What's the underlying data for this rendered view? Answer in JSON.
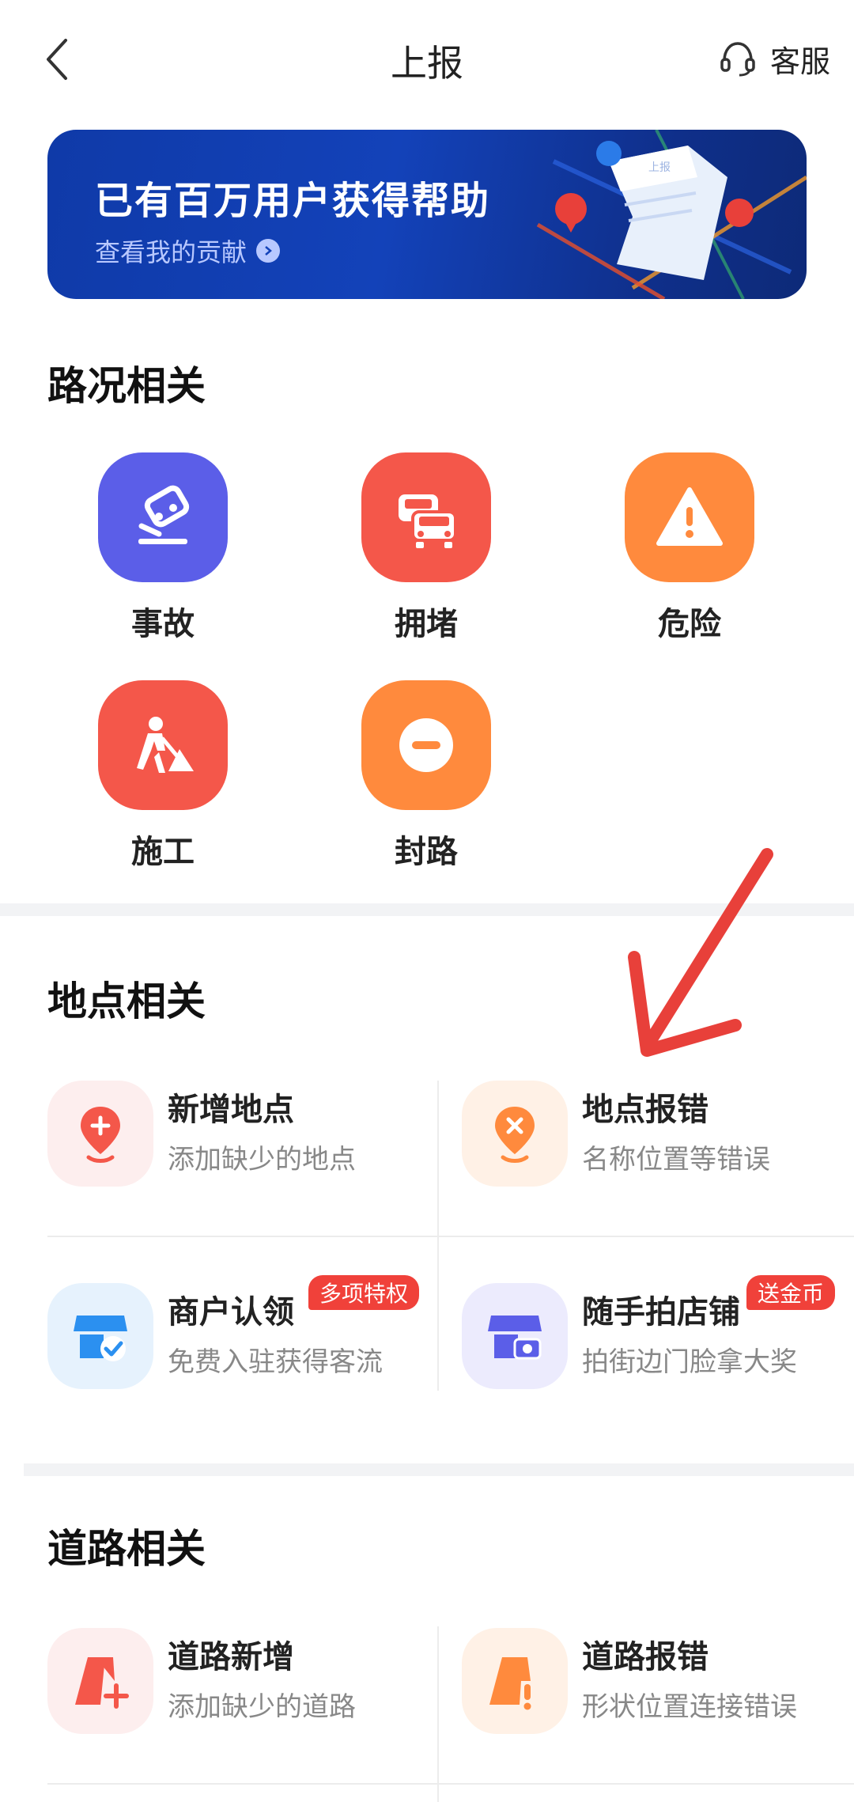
{
  "header": {
    "title": "上报",
    "service_label": "客服"
  },
  "banner": {
    "title": "已有百万用户获得帮助",
    "link_label": "查看我的贡献",
    "paper_text": "上报"
  },
  "road_conditions": {
    "title": "路况相关",
    "items": [
      {
        "label": "事故",
        "icon": "accident-icon",
        "color": "#5b5ee8"
      },
      {
        "label": "拥堵",
        "icon": "traffic-jam-icon",
        "color": "#f4574a"
      },
      {
        "label": "危险",
        "icon": "warning-icon",
        "color": "#ff8a3d"
      },
      {
        "label": "施工",
        "icon": "construction-icon",
        "color": "#f4574a"
      },
      {
        "label": "封路",
        "icon": "road-closed-icon",
        "color": "#ff8a3d"
      }
    ]
  },
  "places": {
    "title": "地点相关",
    "items": [
      {
        "title": "新增地点",
        "subtitle": "添加缺少的地点",
        "icon": "add-location-icon"
      },
      {
        "title": "地点报错",
        "subtitle": "名称位置等错误",
        "icon": "location-error-icon"
      },
      {
        "title": "商户认领",
        "subtitle": "免费入驻获得客流",
        "badge": "多项特权",
        "icon": "merchant-claim-icon"
      },
      {
        "title": "随手拍店铺",
        "subtitle": "拍街边门脸拿大奖",
        "badge": "送金币",
        "icon": "shop-photo-icon"
      }
    ]
  },
  "roads": {
    "title": "道路相关",
    "items": [
      {
        "title": "道路新增",
        "subtitle": "添加缺少的道路",
        "icon": "add-road-icon"
      },
      {
        "title": "道路报错",
        "subtitle": "形状位置连接错误",
        "icon": "road-error-icon"
      }
    ]
  },
  "colors": {
    "accent_red": "#f0413a",
    "banner_blue": "#1342b9"
  }
}
